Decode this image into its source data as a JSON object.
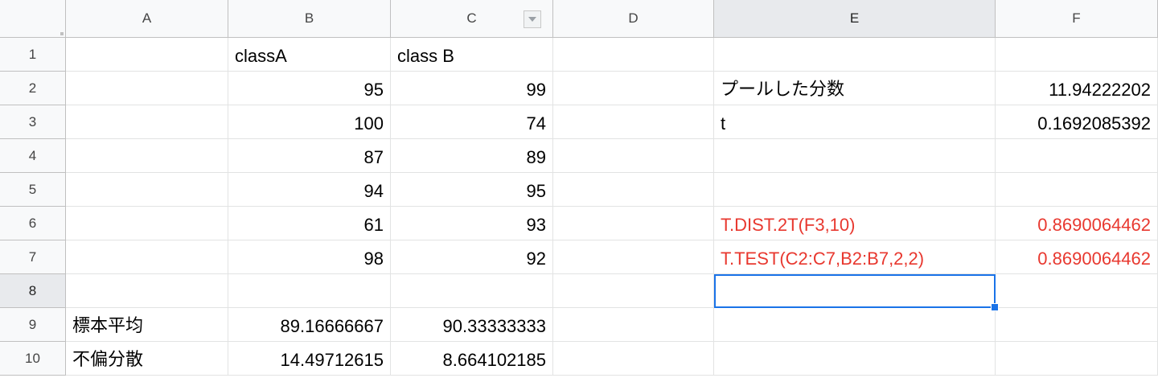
{
  "columns": [
    "A",
    "B",
    "C",
    "D",
    "E",
    "F"
  ],
  "rows": [
    "1",
    "2",
    "3",
    "4",
    "5",
    "6",
    "7",
    "8",
    "9",
    "10"
  ],
  "filter_icon": "triangle-down-icon",
  "selected_cell": "E8",
  "colors": {
    "selection": "#1a73e8",
    "formula_text": "#e8382f",
    "header_bg": "#f8f9fa"
  },
  "cells": {
    "B1": "classA",
    "C1": "class B",
    "B2": "95",
    "C2": "99",
    "E2": "プールした分数",
    "F2": "11.94222202",
    "B3": "100",
    "C3": "74",
    "E3": "t",
    "F3": "0.1692085392",
    "B4": "87",
    "C4": "89",
    "B5": "94",
    "C5": "95",
    "B6": "61",
    "C6": "93",
    "E6": "T.DIST.2T(F3,10)",
    "F6": "0.8690064462",
    "B7": "98",
    "C7": "92",
    "E7": "T.TEST(C2:C7,B2:B7,2,2)",
    "F7": "0.8690064462",
    "A9": "標本平均",
    "B9": "89.16666667",
    "C9": "90.33333333",
    "A10": "不偏分散",
    "B10": "14.49712615",
    "C10": "8.664102185"
  }
}
